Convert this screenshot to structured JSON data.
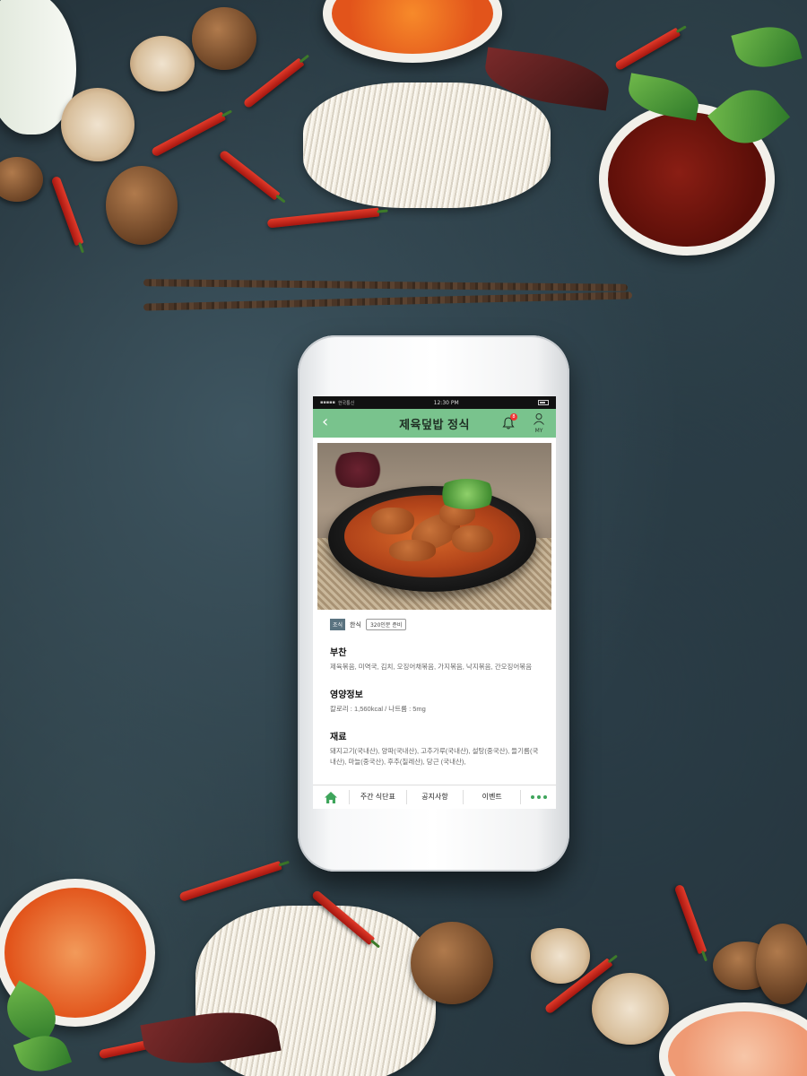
{
  "statusbar": {
    "carrier": "▪▪▪▪▪",
    "network": "한국통신",
    "time": "12:30 PM"
  },
  "appbar": {
    "back_icon": "chevron-left-icon",
    "title": "제육덮밥 정식",
    "notification_count": "8",
    "my_label": "MY"
  },
  "meal": {
    "meal_time_tag": "조식",
    "cuisine": "한식",
    "servings_tag": "320인분 준비"
  },
  "sections": {
    "side_dishes": {
      "heading": "부찬",
      "text": "제육볶음, 미역국, 김치, 오징어채볶음, 가지볶음, 낙지볶음, 간오징어볶음"
    },
    "nutrition": {
      "heading": "영양정보",
      "text": "칼로리 : 1,560kcal  /  나트륨 : 5mg"
    },
    "ingredients": {
      "heading": "재료",
      "text": "돼지고기(국내산), 양파(국내산), 고추가루(국내산), 설탕(중국산), 들기름(국내산), 마늘(중국산), 후추(칠레산), 당근 (국내산),"
    }
  },
  "bottomnav": {
    "home_icon": "home-icon",
    "weekly_menu": "주간 식단표",
    "notice": "공지사항",
    "event": "이벤트",
    "more_icon": "more-dots-icon"
  },
  "colors": {
    "appbar": "#79c38d",
    "accent_green": "#3ea55b",
    "tag_dark": "#5a7380",
    "badge": "#e33333"
  }
}
